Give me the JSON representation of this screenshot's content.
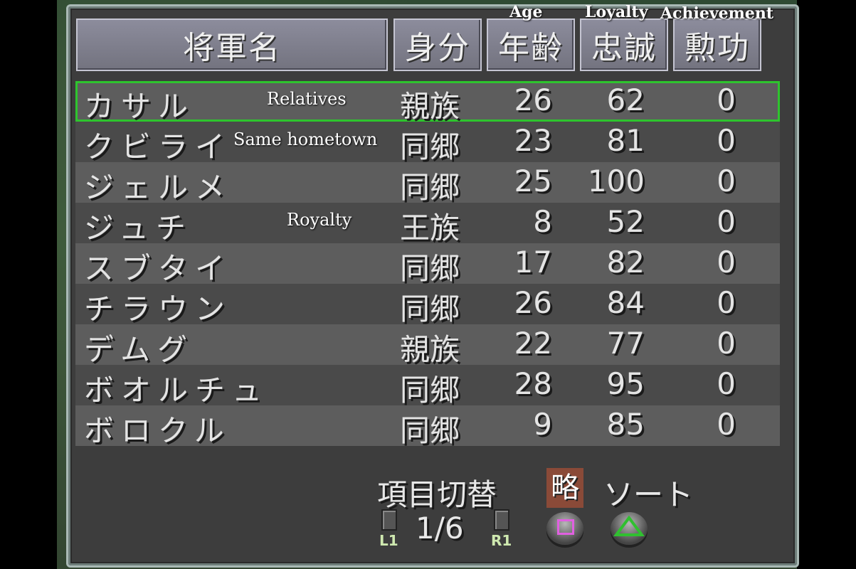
{
  "headers": {
    "name": "将軍名",
    "rank": "身分",
    "age": "年齢",
    "loyalty": "忠誠",
    "achievement": "勲功"
  },
  "header_translations": {
    "age": "Age",
    "loyalty": "Loyalty",
    "achievement": "Achievement"
  },
  "rows": [
    {
      "name": "カサル",
      "rank": "親族",
      "age": "26",
      "loyalty": "62",
      "achievement": "0"
    },
    {
      "name": "クビライ",
      "rank": "同郷",
      "age": "23",
      "loyalty": "81",
      "achievement": "0"
    },
    {
      "name": "ジェルメ",
      "rank": "同郷",
      "age": "25",
      "loyalty": "100",
      "achievement": "0"
    },
    {
      "name": "ジュチ",
      "rank": "王族",
      "age": "8",
      "loyalty": "52",
      "achievement": "0"
    },
    {
      "name": "スブタイ",
      "rank": "同郷",
      "age": "17",
      "loyalty": "82",
      "achievement": "0"
    },
    {
      "name": "チラウン",
      "rank": "同郷",
      "age": "26",
      "loyalty": "84",
      "achievement": "0"
    },
    {
      "name": "デムグ",
      "rank": "親族",
      "age": "22",
      "loyalty": "77",
      "achievement": "0"
    },
    {
      "name": "ボオルチュ",
      "rank": "同郷",
      "age": "28",
      "loyalty": "95",
      "achievement": "0"
    },
    {
      "name": "ボロクル",
      "rank": "同郷",
      "age": "9",
      "loyalty": "85",
      "achievement": "0"
    }
  ],
  "row_notes": {
    "relatives": "Relatives",
    "same_hometown": "Same hometown",
    "royalty": "Royalty"
  },
  "footer": {
    "switch_label": "項目切替",
    "page": "1/6",
    "l1": "L1",
    "r1": "R1",
    "ryaku": "略",
    "sort": "ソート"
  },
  "colors": {
    "selection": "#2ec42e",
    "square_button": "#e060e0",
    "triangle_button": "#30c030"
  }
}
